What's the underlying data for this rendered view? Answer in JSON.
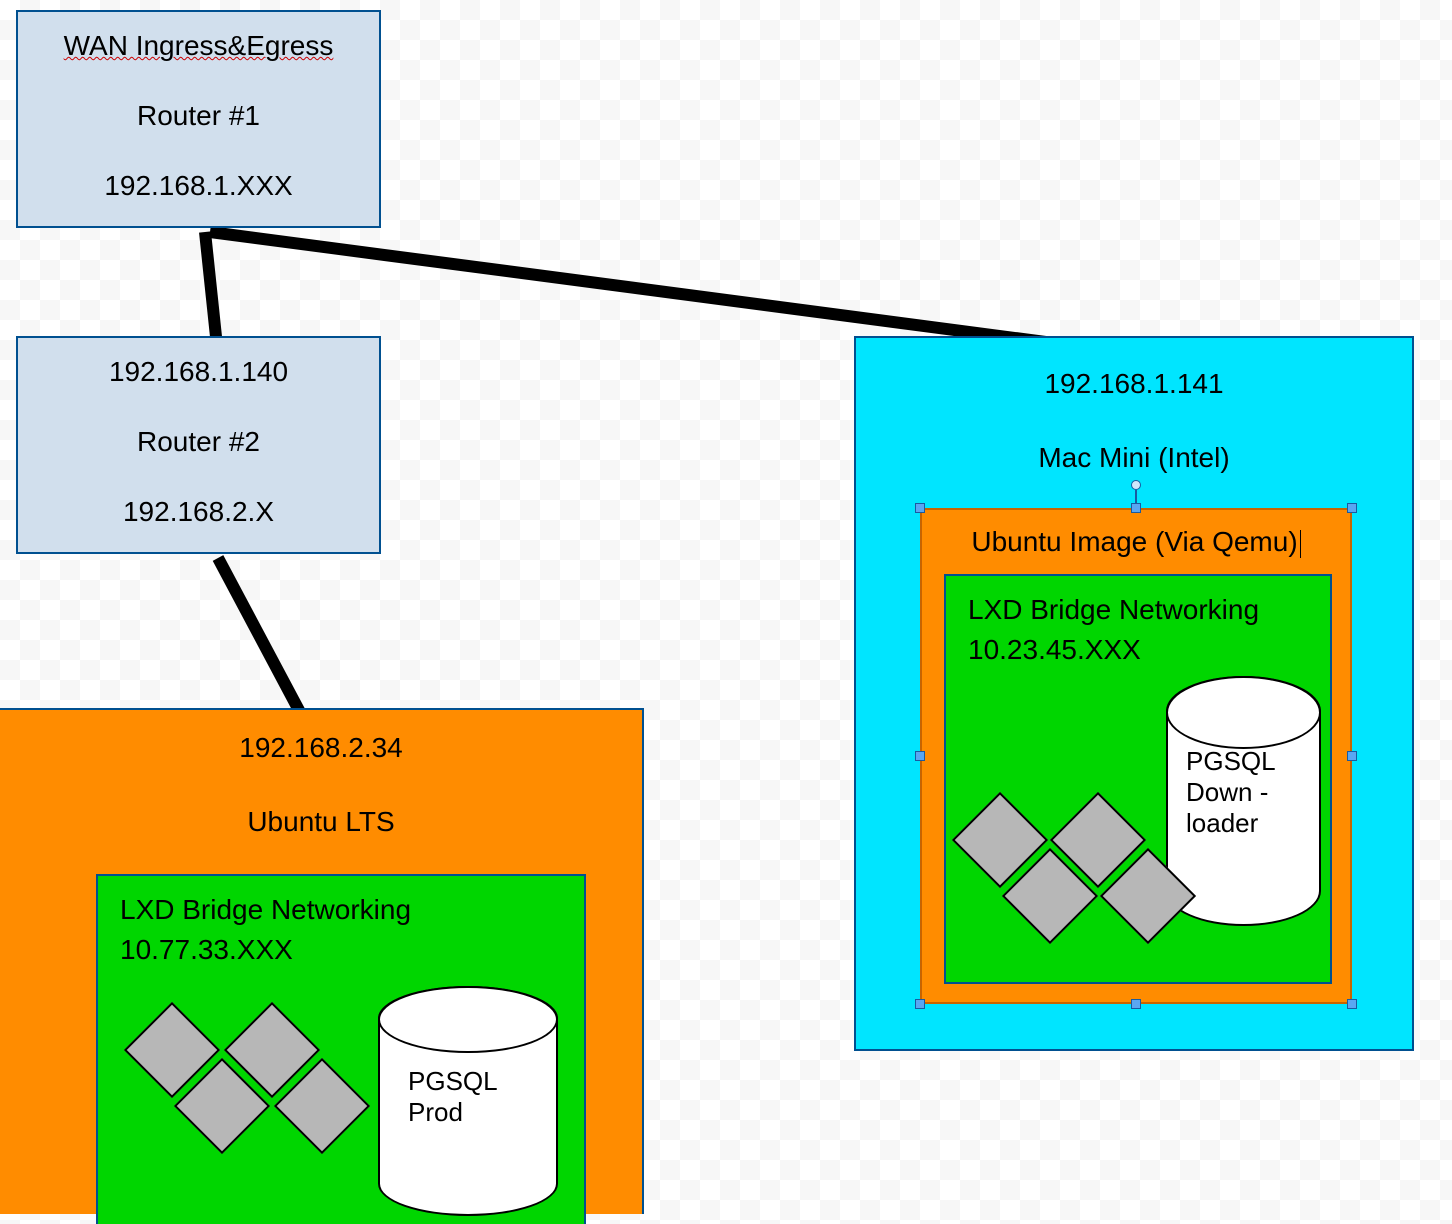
{
  "router1": {
    "line1": "WAN Ingress&Egress",
    "line2": "Router #1",
    "line3": "192.168.1.XXX"
  },
  "router2": {
    "line1": "192.168.1.140",
    "line2": "Router #2",
    "line3": "192.168.2.X"
  },
  "ubuntu_left": {
    "ip": "192.168.2.34",
    "os": "Ubuntu LTS",
    "lxd_title": "LXD Bridge Networking",
    "lxd_subnet": "10.77.33.XXX",
    "db_label": "PGSQL Prod"
  },
  "mac_mini": {
    "ip": "192.168.1.141",
    "name": "Mac Mini (Intel)",
    "qemu_label": "Ubuntu Image (Via Qemu)",
    "lxd_title": "LXD Bridge Networking",
    "lxd_subnet": "10.23.45.XXX",
    "db_label": "PGSQL Down - loader"
  }
}
